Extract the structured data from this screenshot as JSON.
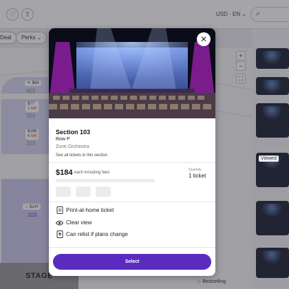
{
  "header": {
    "currency": "USD",
    "language": "EN",
    "icons": [
      "heart-icon",
      "share-icon",
      "search-icon"
    ]
  },
  "filters": [
    {
      "label": "Deal"
    },
    {
      "label": "Perks ⌄"
    }
  ],
  "map": {
    "sections": [
      {
        "number": "403",
        "price": "$64",
        "tickets_left": ""
      },
      {
        "number": "303",
        "price": "$77",
        "tickets_left": "1 left"
      },
      {
        "number": "203",
        "price": "$196",
        "tickets_left": "6 left"
      },
      {
        "number": "103",
        "price": "$147",
        "tickets_left": ""
      }
    ],
    "stage_label": "STAGE",
    "zoom_in": "+",
    "zoom_out": "−"
  },
  "sidebar": {
    "viewed_badge": "Viewed",
    "bestselling": "Bestselling"
  },
  "modal": {
    "section_title": "Section 103",
    "row": "Row P",
    "zone": "Zone Orchestra",
    "see_all_link": "See all tickets in this section",
    "price": "$184",
    "price_note": "each including fees",
    "quantity_label": "Quantity",
    "quantity_value": "1 ticket",
    "features": [
      {
        "icon": "ticket-icon",
        "label": "Print-at-home ticket"
      },
      {
        "icon": "eye-icon",
        "label": "Clear view"
      },
      {
        "icon": "relist-icon",
        "label": "Can relist if plans change"
      }
    ],
    "select_button": "Select",
    "close_icon": "close-icon"
  },
  "colors": {
    "accent": "#5b2bbf",
    "section_fill": "#d6d2f0",
    "stage": "#9a9a9a"
  }
}
